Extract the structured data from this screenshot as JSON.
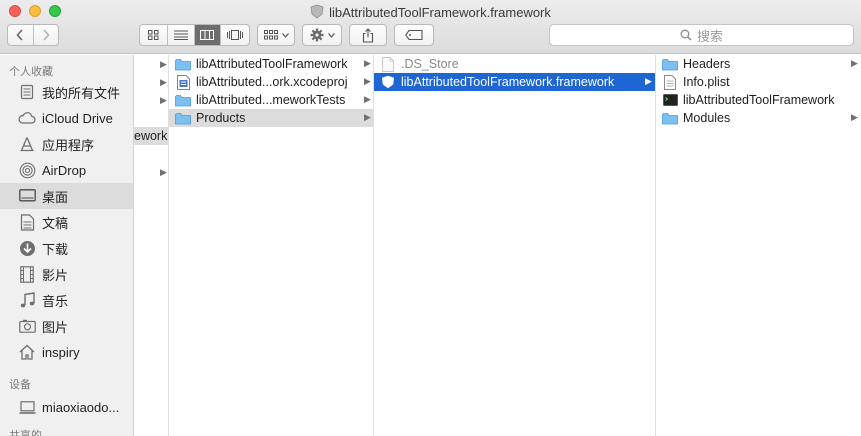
{
  "window": {
    "title": "libAttributedToolFramework.framework"
  },
  "toolbar": {
    "search_placeholder": "搜索",
    "view_modes": [
      "icon",
      "list",
      "column",
      "cover-flow"
    ],
    "active_view": "column"
  },
  "sidebar": {
    "favorites_header": "个人收藏",
    "favorites": [
      {
        "label": "我的所有文件",
        "icon": "all-files-icon"
      },
      {
        "label": "iCloud Drive",
        "icon": "cloud-icon"
      },
      {
        "label": "应用程序",
        "icon": "applications-icon"
      },
      {
        "label": "AirDrop",
        "icon": "airdrop-icon"
      },
      {
        "label": "桌面",
        "icon": "desktop-icon",
        "selected": true
      },
      {
        "label": "文稿",
        "icon": "documents-icon"
      },
      {
        "label": "下载",
        "icon": "downloads-icon"
      },
      {
        "label": "影片",
        "icon": "movies-icon"
      },
      {
        "label": "音乐",
        "icon": "music-icon"
      },
      {
        "label": "图片",
        "icon": "pictures-icon"
      },
      {
        "label": "inspiry",
        "icon": "home-icon"
      }
    ],
    "devices_header": "设备",
    "devices": [
      {
        "label": "miaoxiaodo...",
        "icon": "computer-icon"
      }
    ],
    "shared_header": "共享的"
  },
  "columns": {
    "col0": {
      "partial_label": "ework"
    },
    "col1": [
      {
        "label": "libAttributedToolFramework",
        "type": "folder",
        "chevron": true
      },
      {
        "label": "libAttributed...ork.xcodeproj",
        "type": "xcodeproj",
        "chevron": true
      },
      {
        "label": "libAttributed...meworkTests",
        "type": "folder",
        "chevron": true
      },
      {
        "label": "Products",
        "type": "folder",
        "chevron": true,
        "highlighted": true
      }
    ],
    "col2": [
      {
        "label": ".DS_Store",
        "type": "file",
        "muted": true
      },
      {
        "label": "libAttributedToolFramework.framework",
        "type": "framework",
        "chevron": true,
        "selected": true
      }
    ],
    "col3": [
      {
        "label": "Headers",
        "type": "folder",
        "chevron": true
      },
      {
        "label": "Info.plist",
        "type": "plist"
      },
      {
        "label": "libAttributedToolFramework",
        "type": "exec"
      },
      {
        "label": "Modules",
        "type": "folder",
        "chevron": true
      }
    ]
  },
  "colors": {
    "selection": "#1f66d5",
    "highlight": "#dcdcdc",
    "folder": "#6fb6ef"
  }
}
